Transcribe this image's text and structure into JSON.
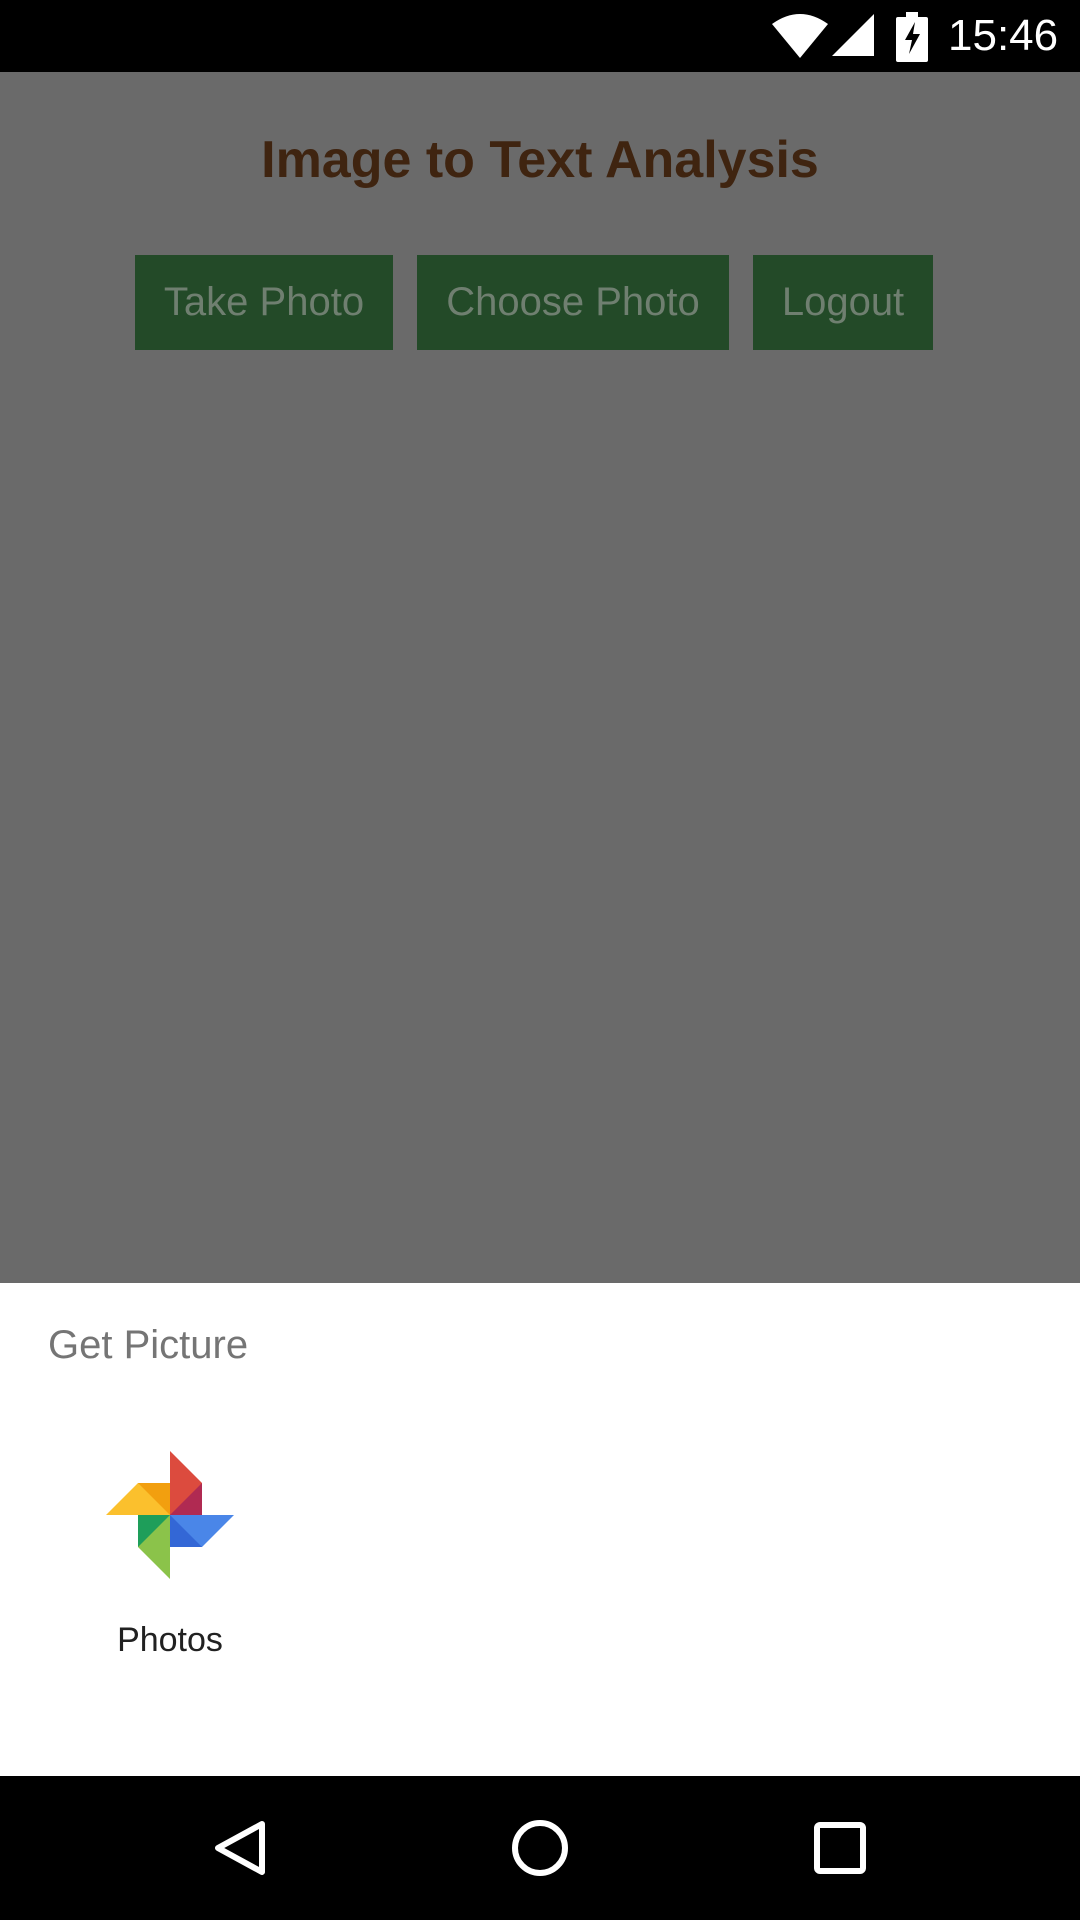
{
  "status_bar": {
    "time": "15:46",
    "icons": [
      "wifi-icon",
      "signal-icon",
      "battery-charging-icon"
    ]
  },
  "app": {
    "title": "Image to Text Analysis",
    "buttons": {
      "take_photo": "Take Photo",
      "choose_photo": "Choose Photo",
      "logout": "Logout"
    },
    "colors": {
      "title": "#3f2410",
      "button_bg": "#234a28",
      "scrim": "#6a6a6a"
    }
  },
  "chooser": {
    "title": "Get Picture",
    "options": [
      {
        "label": "Photos",
        "icon": "google-photos-icon"
      }
    ]
  },
  "nav_bar": {
    "icons": [
      "back-icon",
      "home-icon",
      "recents-icon"
    ]
  }
}
